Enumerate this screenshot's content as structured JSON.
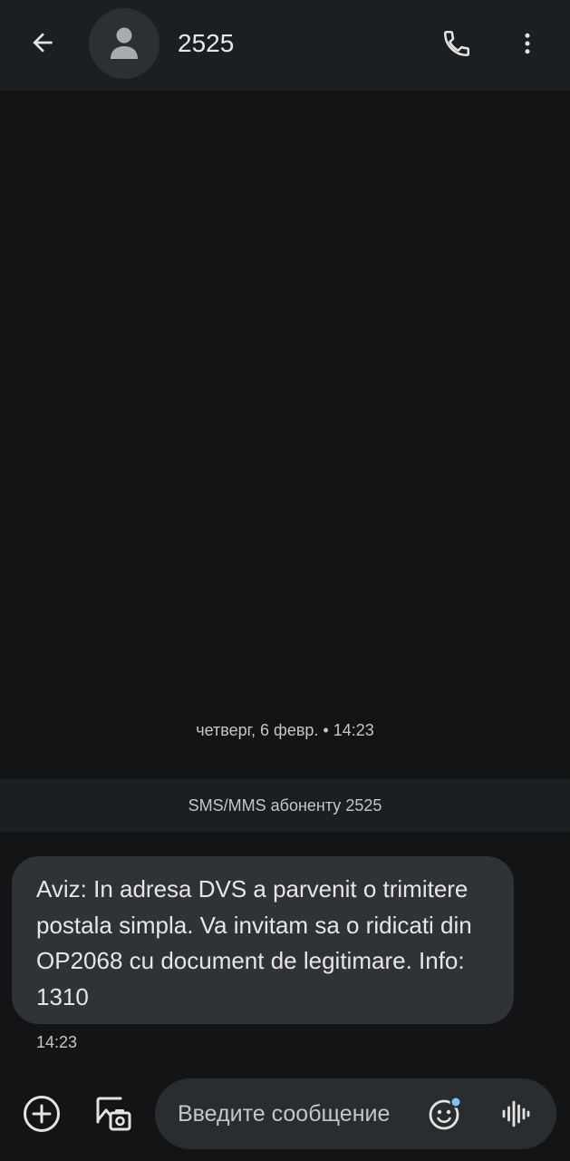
{
  "header": {
    "contact_name": "2525",
    "back_icon": "arrow-back-icon",
    "avatar_icon": "person-icon",
    "call_icon": "phone-icon",
    "more_icon": "more-vert-icon"
  },
  "thread": {
    "date_separator": "четверг, 6 февр. • 14:23",
    "info_banner": "SMS/MMS абоненту 2525",
    "messages": [
      {
        "direction": "incoming",
        "text": "Aviz: In adresa DVS a parvenit o trimitere postala simpla. Va invitam sa o ridicati din OP2068 cu document de legitimare. Info: 1310",
        "time": "14:23"
      }
    ]
  },
  "composer": {
    "placeholder": "Введите сообщение",
    "value": "",
    "add_icon": "add-circle-icon",
    "gallery_icon": "gallery-camera-icon",
    "emoji_icon": "emoji-icon",
    "voice_icon": "voice-waveform-icon"
  },
  "colors": {
    "background": "#121416",
    "bar": "#1c1f22",
    "bubble": "#2f3236",
    "composer": "#2a2d30",
    "accent_dot": "#7cc4f8"
  }
}
